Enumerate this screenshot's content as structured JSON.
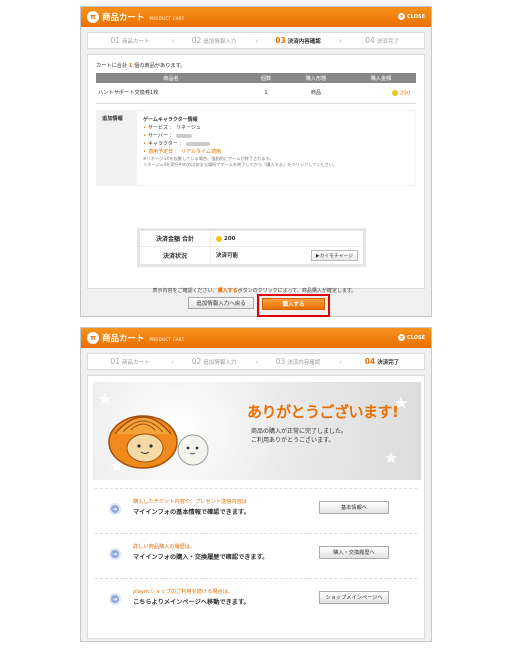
{
  "window": {
    "title": "商品カート",
    "subtitle": "PRODUCT CART",
    "close_label": "CLOSE"
  },
  "steps": [
    {
      "num": "01",
      "label": "商品カート"
    },
    {
      "num": "02",
      "label": "追加情報入力"
    },
    {
      "num": "03",
      "label": "決済内容確認"
    },
    {
      "num": "04",
      "label": "決済完了"
    }
  ],
  "confirm": {
    "count_prefix": "カートに合計",
    "count": "1",
    "count_suffix": "個の商品があります。",
    "table_headers": [
      "商品名",
      "個数",
      "購入形態",
      "購入金額"
    ],
    "rows": [
      {
        "name": "ハントサポート交換券1枚",
        "qty": "1",
        "form": "商品",
        "price": "200"
      }
    ],
    "extra_label": "追加情報",
    "extra_heading": "ゲームキャラクター情報",
    "service_label": "サービス ：",
    "service_value": "リネージュ",
    "server_label": "サーバー ：",
    "character_label": "キャラクター ：",
    "apply_label": "適用予定日 ：",
    "apply_value": "リアルタイム適用",
    "note1": "※リネージュIIを起動している場合、強制的にゲームが終了されます。",
    "note2": "リネージュIIを実行中の方は安全な場所でゲームを終了してから「購入する」をクリックしてください。",
    "total_label": "決済金額  合計",
    "total_value": "200",
    "status_label": "決済状況",
    "status_value": "決済可能",
    "charge_button": "▶カイモチャージ",
    "confirm_pre": "表示内容をご確認ください。",
    "confirm_buy": "購入する",
    "confirm_post": "ボタンのクリックによって、商品購入が確定します。",
    "back_button": "追加情報入力へ戻る",
    "buy_button": "購入する"
  },
  "complete": {
    "thanks": "ありがとうございます!",
    "sub1": "商品の購入が正常に完了しました。",
    "sub2": "ご利用ありがとうございます。",
    "rows": [
      {
        "t1": "購入したチケット内容や、プレゼント送信内容は",
        "t2": "マイインフォの基本情報で確認できます。",
        "button": "基本情報へ"
      },
      {
        "t1": "詳しい商品購入の履歴は、",
        "t2": "マイインフォの購入・交換履歴で確認できます。",
        "button": "購入・交換履歴へ"
      },
      {
        "t1": "playncショップのご利用を続ける場合は、",
        "t2": "こちらよりメインページへ移動できます。",
        "button": "ショップメインページへ"
      }
    ]
  },
  "colors": {
    "accent": "#ea6f00",
    "highlight_outline": "#e00000"
  }
}
